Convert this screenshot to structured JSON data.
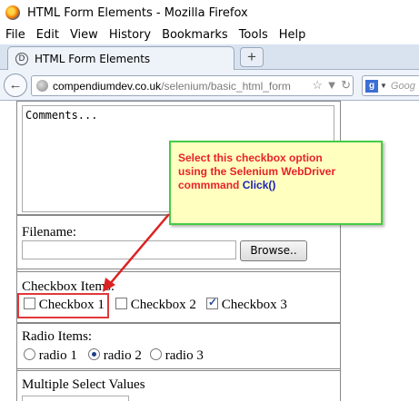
{
  "window": {
    "title": "HTML Form Elements - Mozilla Firefox"
  },
  "menubar": {
    "items": [
      {
        "label": "File"
      },
      {
        "label": "Edit"
      },
      {
        "label": "View"
      },
      {
        "label": "History"
      },
      {
        "label": "Bookmarks"
      },
      {
        "label": "Tools"
      },
      {
        "label": "Help"
      }
    ]
  },
  "tab": {
    "title": "HTML Form Elements",
    "new_tab_label": "+"
  },
  "navbar": {
    "url_host": "compendiumdev.co.uk",
    "url_path": "/selenium/basic_html_form",
    "search_placeholder": "Goog",
    "search_engine_letter": "g"
  },
  "form": {
    "comments_text": "Comments...",
    "filename_label": "Filename:",
    "browse_label": "Browse..",
    "checkbox_heading": "Checkbox Items:",
    "checkboxes": [
      {
        "label": "Checkbox 1",
        "checked": false
      },
      {
        "label": "Checkbox 2",
        "checked": false
      },
      {
        "label": "Checkbox 3",
        "checked": true
      }
    ],
    "radio_heading": "Radio Items:",
    "radios": [
      {
        "label": "radio 1",
        "checked": false
      },
      {
        "label": "radio 2",
        "checked": true
      },
      {
        "label": "radio 3",
        "checked": false
      }
    ],
    "multi_select_heading": "Multiple Select Values"
  },
  "callout": {
    "line1": "Select this checkbox option",
    "line2": "using the Selenium WebDriver",
    "line3_prefix": "commmand ",
    "line3_keyword": "Click()",
    "colors": {
      "text": "#e8222a",
      "keyword": "#1a22b8",
      "border": "#44cc44",
      "background": "#ffffc0"
    }
  }
}
